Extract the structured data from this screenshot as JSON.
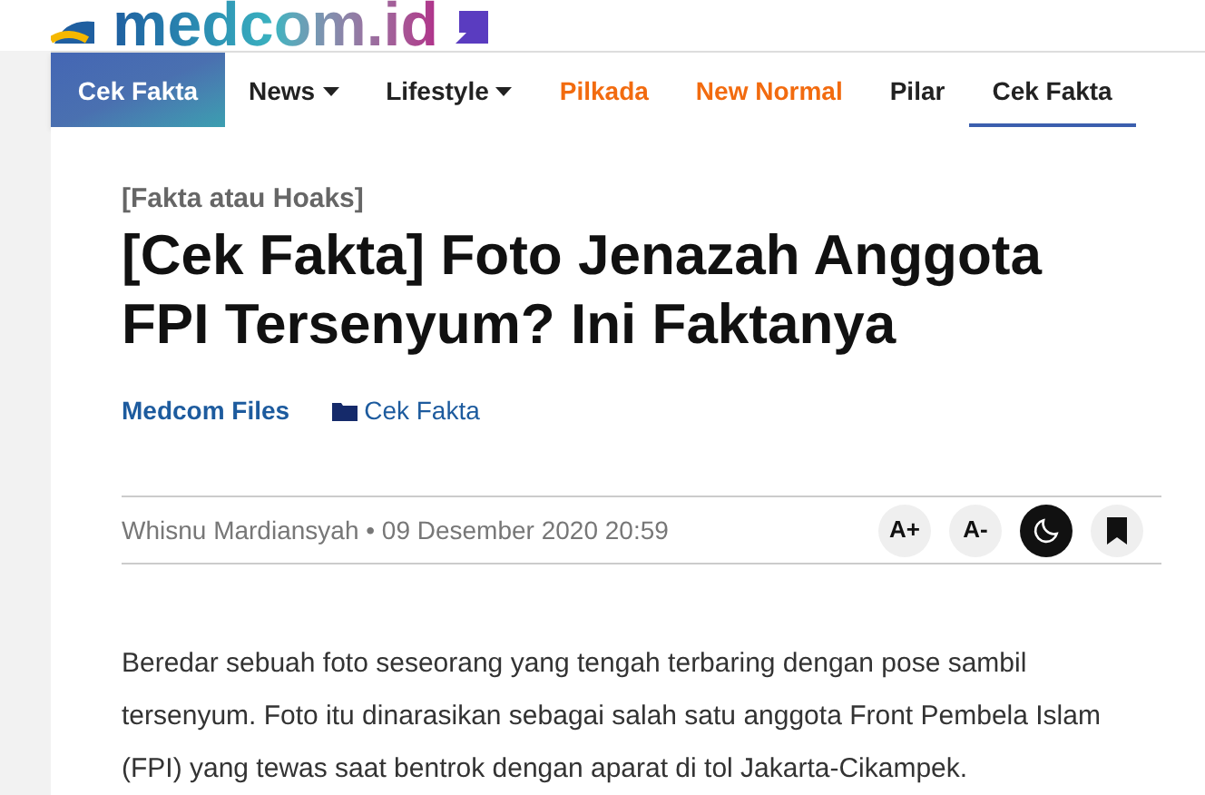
{
  "logo": {
    "text": "medcom.id"
  },
  "nav": [
    {
      "label": "Cek Fakta",
      "kind": "brand",
      "selected": false
    },
    {
      "label": "News",
      "kind": "dropdown",
      "selected": false
    },
    {
      "label": "Lifestyle",
      "kind": "dropdown",
      "selected": false
    },
    {
      "label": "Pilkada",
      "kind": "highlight",
      "selected": false
    },
    {
      "label": "New Normal",
      "kind": "highlight",
      "selected": false
    },
    {
      "label": "Pilar",
      "kind": "plain",
      "selected": false
    },
    {
      "label": "Cek Fakta",
      "kind": "plain",
      "selected": true
    }
  ],
  "article": {
    "kicker": "[Fakta atau Hoaks]",
    "title": "[Cek Fakta] Foto Jenazah Anggota FPI Tersenyum? Ini Faktanya",
    "source": "Medcom Files",
    "category": "Cek Fakta",
    "byline": "Whisnu Mardiansyah • 09 Desember 2020 20:59",
    "tools": [
      {
        "kind": "text",
        "label": "A+"
      },
      {
        "kind": "text",
        "label": "A-"
      },
      {
        "kind": "dark-mode"
      },
      {
        "kind": "bookmark"
      }
    ],
    "body": "Beredar sebuah foto seseorang yang tengah terbaring dengan pose sambil tersenyum. Foto itu dinarasikan sebagai salah satu anggota Front Pembela Islam (FPI) yang tewas saat bentrok dengan aparat di tol Jakarta-Cikampek."
  }
}
